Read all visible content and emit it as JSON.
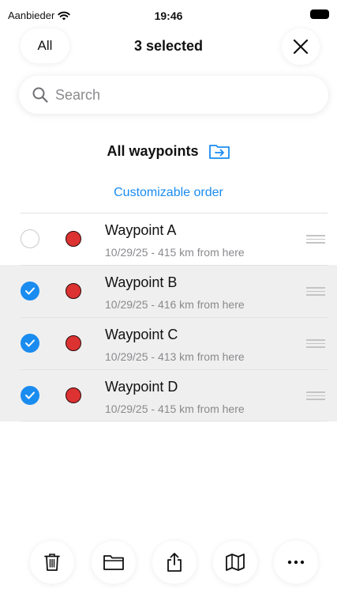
{
  "status_bar": {
    "carrier": "Aanbieder",
    "time": "19:46"
  },
  "header": {
    "all_label": "All",
    "title": "3 selected"
  },
  "search": {
    "placeholder": "Search"
  },
  "section": {
    "title": "All waypoints",
    "order_label": "Customizable order"
  },
  "waypoints": [
    {
      "name": "Waypoint A",
      "meta": "10/29/25 - 415 km from here",
      "selected": false
    },
    {
      "name": "Waypoint B",
      "meta": "10/29/25 - 416 km from here",
      "selected": true
    },
    {
      "name": "Waypoint C",
      "meta": "10/29/25 - 413 km from here",
      "selected": true
    },
    {
      "name": "Waypoint D",
      "meta": "10/29/25 - 415 km from here",
      "selected": true
    }
  ],
  "toolbar": [
    "trash-icon",
    "folder-icon",
    "share-icon",
    "map-icon",
    "more-icon"
  ],
  "colors": {
    "accent": "#1a8cf0",
    "waypoint": "#dc3232",
    "selected_row": "#efefef"
  }
}
